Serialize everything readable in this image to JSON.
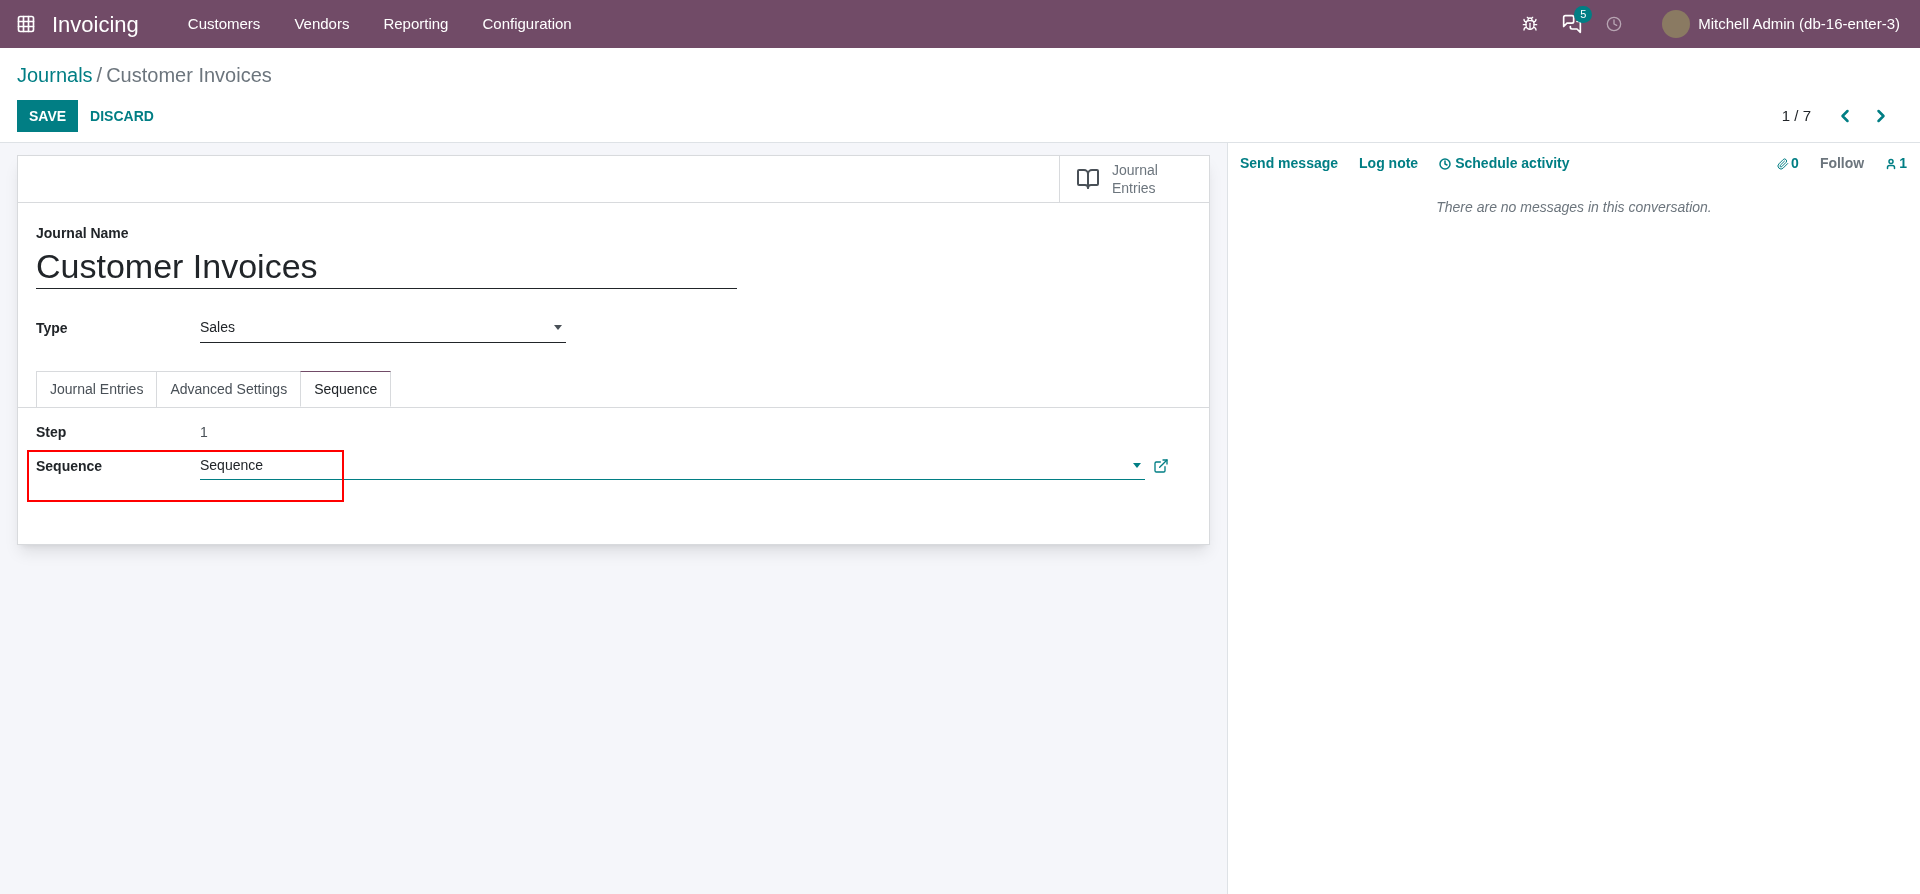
{
  "navbar": {
    "app_name": "Invoicing",
    "menu": [
      "Customers",
      "Vendors",
      "Reporting",
      "Configuration"
    ],
    "message_count": "5",
    "user": "Mitchell Admin (db-16-enter-3)"
  },
  "breadcrumb": {
    "parent": "Journals",
    "separator": "/",
    "current": "Customer Invoices"
  },
  "actions": {
    "save": "SAVE",
    "discard": "DISCARD"
  },
  "pager": {
    "value": "1 / 7"
  },
  "smart_button": {
    "line_1": "Journal",
    "line_2": "Entries"
  },
  "form": {
    "name_label": "Journal Name",
    "name_value": "Customer Invoices",
    "type_label": "Type",
    "type_value": "Sales"
  },
  "tabs": [
    {
      "label": "Journal Entries",
      "selected": false
    },
    {
      "label": "Advanced Settings",
      "selected": false
    },
    {
      "label": "Sequence",
      "selected": true
    }
  ],
  "sequence_tab": {
    "step_label": "Step",
    "step_value": "1",
    "sequence_label": "Sequence",
    "sequence_value": "Sequence",
    "highlighted": true
  },
  "chatter": {
    "send_message": "Send message",
    "log_note": "Log note",
    "schedule_activity": "Schedule activity",
    "attachments": "0",
    "follow": "Follow",
    "followers": "1",
    "empty_text": "There are no messages in this conversation."
  }
}
